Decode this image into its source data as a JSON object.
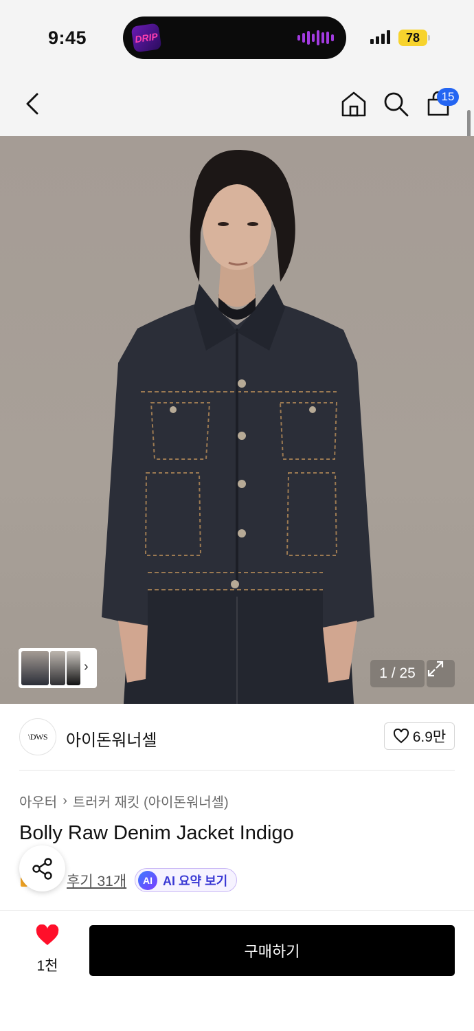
{
  "status_bar": {
    "time": "9:45",
    "island_app_logo": "DRIP",
    "battery": "78"
  },
  "nav": {
    "back_icon": "chevron-left-icon",
    "home_icon": "home-icon",
    "search_icon": "search-icon",
    "cart_icon": "shopping-bag-icon",
    "cart_count": "15"
  },
  "gallery": {
    "counter": "1 / 25",
    "expand_icon": "expand-icon",
    "thumbnails_chevron": "›"
  },
  "brand": {
    "logo_text": "\\DWS",
    "name": "아이돈워너셀",
    "like_count": "6.9만"
  },
  "product": {
    "breadcrumb": [
      "아우터",
      "트러커 재킷 (아이돈워너셀)"
    ],
    "breadcrumb_sep": "›",
    "title": "Bolly Raw Denim Jacket Indigo",
    "reviews": "후기 31개",
    "ai_badge": "AI",
    "ai_summary": "AI 요약 보기"
  },
  "bottom_bar": {
    "wish_count": "1천",
    "buy_label": "구매하기"
  },
  "colors": {
    "accent_blue": "#2465f2",
    "heart_red": "#ff0f2a",
    "buy_button": "#000000",
    "battery": "#f7d32d"
  }
}
